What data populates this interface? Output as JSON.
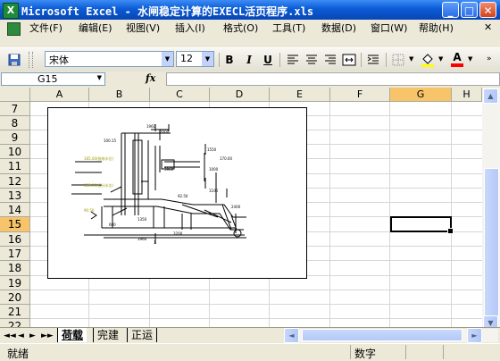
{
  "window": {
    "title": "Microsoft Excel - 水闸稳定计算的EXECL活页程序.xls",
    "app_icon": "excel-icon",
    "controls": {
      "minimize": "_",
      "maximize": "□",
      "close": "✕"
    }
  },
  "menu": {
    "items": [
      "文件(F)",
      "编辑(E)",
      "视图(V)",
      "插入(I)",
      "格式(O)",
      "工具(T)",
      "数据(D)",
      "窗口(W)",
      "帮助(H)"
    ],
    "doc_close": "✕"
  },
  "toolbar": {
    "font_name": "宋体",
    "font_size": "12",
    "bold": "B",
    "italic": "I",
    "underline": "U",
    "fill_color": "#ffff00",
    "font_color": "#ff0000",
    "font_color_label": "A"
  },
  "formula_bar": {
    "name_box": "G15",
    "fx": "fx",
    "content": ""
  },
  "grid": {
    "columns": [
      "A",
      "B",
      "C",
      "D",
      "E",
      "F",
      "G",
      "H"
    ],
    "rows": [
      "7",
      "8",
      "9",
      "10",
      "11",
      "12",
      "13",
      "14",
      "15",
      "16",
      "17",
      "18",
      "19",
      "20",
      "21",
      "22"
    ],
    "active_column": "G",
    "active_row": "15"
  },
  "drawing": {
    "annotations": [
      "1960",
      "2000",
      "1550",
      "100.15",
      "185.00(校核水位)",
      "185.00(设计水位)",
      "92.50",
      "3960",
      "1000",
      "170.00",
      "1100",
      "600",
      "1350",
      "3200",
      "3960",
      "2400",
      "90.50",
      "1"
    ]
  },
  "sheets": {
    "nav": [
      "◄◄",
      "◄",
      "►",
      "►►"
    ],
    "tabs": [
      "荷载",
      "完建",
      "正运"
    ],
    "active": "荷载"
  },
  "status": {
    "left": "就绪",
    "mode": "数字"
  }
}
